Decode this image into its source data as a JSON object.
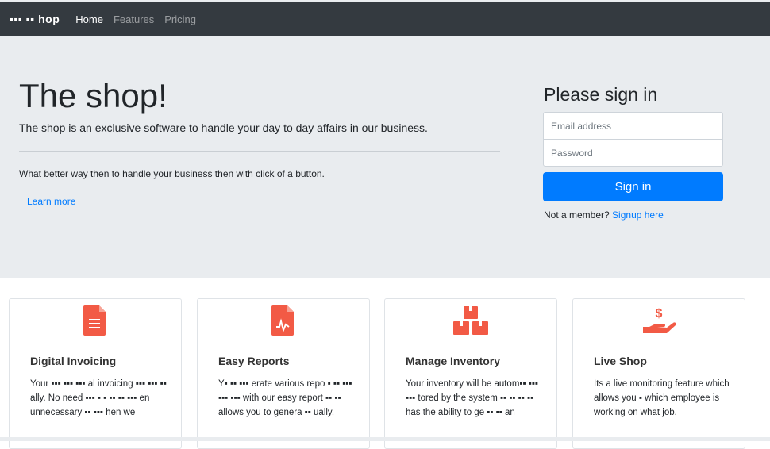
{
  "navbar": {
    "brand": "▪▪▪ ▪▪ hop",
    "links": [
      "Home",
      "Features",
      "Pricing"
    ]
  },
  "hero": {
    "title": "The shop!",
    "lead": "The shop is an exclusive software to handle your day to day affairs in our business.",
    "text": "What better way then to handle your business then with click of a button.",
    "learn_more": "Learn more"
  },
  "signin": {
    "title": "Please sign in",
    "email_placeholder": "Email address",
    "password_placeholder": "Password",
    "button": "Sign in",
    "member_text": "Not a member?",
    "signup_link": "Signup here"
  },
  "features": [
    {
      "icon": "invoice-icon",
      "title": "Digital Invoicing",
      "text": "Your ▪▪▪ ▪▪▪ ▪▪▪ al invoicing ▪▪▪ ▪▪▪ ▪▪ ally. No need ▪▪▪ ▪ ▪ ▪▪ ▪▪ ▪▪▪ en unnecessary ▪▪ ▪▪▪ hen we"
    },
    {
      "icon": "report-icon",
      "title": "Easy Reports",
      "text": "Y▪ ▪▪ ▪▪▪ erate various repo ▪ ▪▪ ▪▪▪ ▪▪▪ ▪▪▪ with our easy report ▪▪ ▪▪ allows you to genera ▪▪ ually,"
    },
    {
      "icon": "boxes-icon",
      "title": "Manage Inventory",
      "text": "Your inventory will be autom▪▪ ▪▪▪ ▪▪▪ tored by the system ▪▪ ▪▪ ▪▪ ▪▪ has the ability to ge ▪▪ ▪▪ an"
    },
    {
      "icon": "hand-dollar-icon",
      "title": "Live Shop",
      "text": "Its a live monitoring feature which allows you ▪ which employee is working on what job."
    }
  ],
  "colors": {
    "accent": "#007bff",
    "icon": "#f25a45",
    "navbar": "#343a40"
  }
}
